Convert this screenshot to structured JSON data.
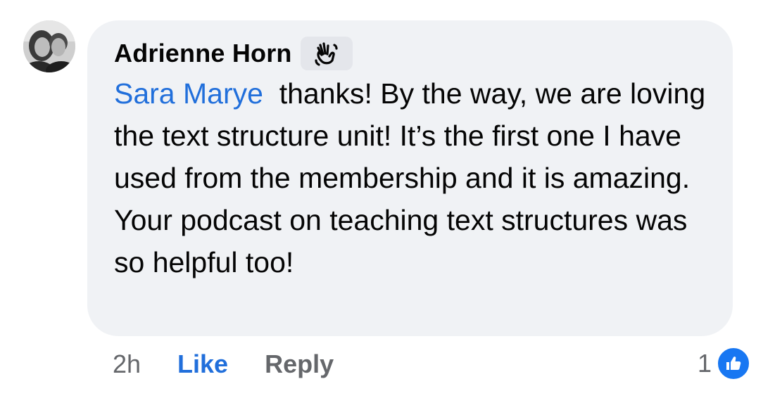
{
  "comment": {
    "author": "Adrienne Horn",
    "author_badge_icon": "waving-hand-icon",
    "mention": "Sara Marye",
    "body": "thanks! By the way, we are loving the text structure unit! It’s the first one I have used from the membership and it is amazing. Your podcast on teaching text structures was so helpful too!"
  },
  "actions": {
    "timestamp": "2h",
    "like_label": "Like",
    "reply_label": "Reply"
  },
  "reactions": {
    "count": "1",
    "icon": "like-reaction-icon"
  },
  "colors": {
    "bubble": "#f0f2f5",
    "link_blue": "#216fdb",
    "muted_gray": "#65676b",
    "reaction_blue": "#1877f2"
  }
}
